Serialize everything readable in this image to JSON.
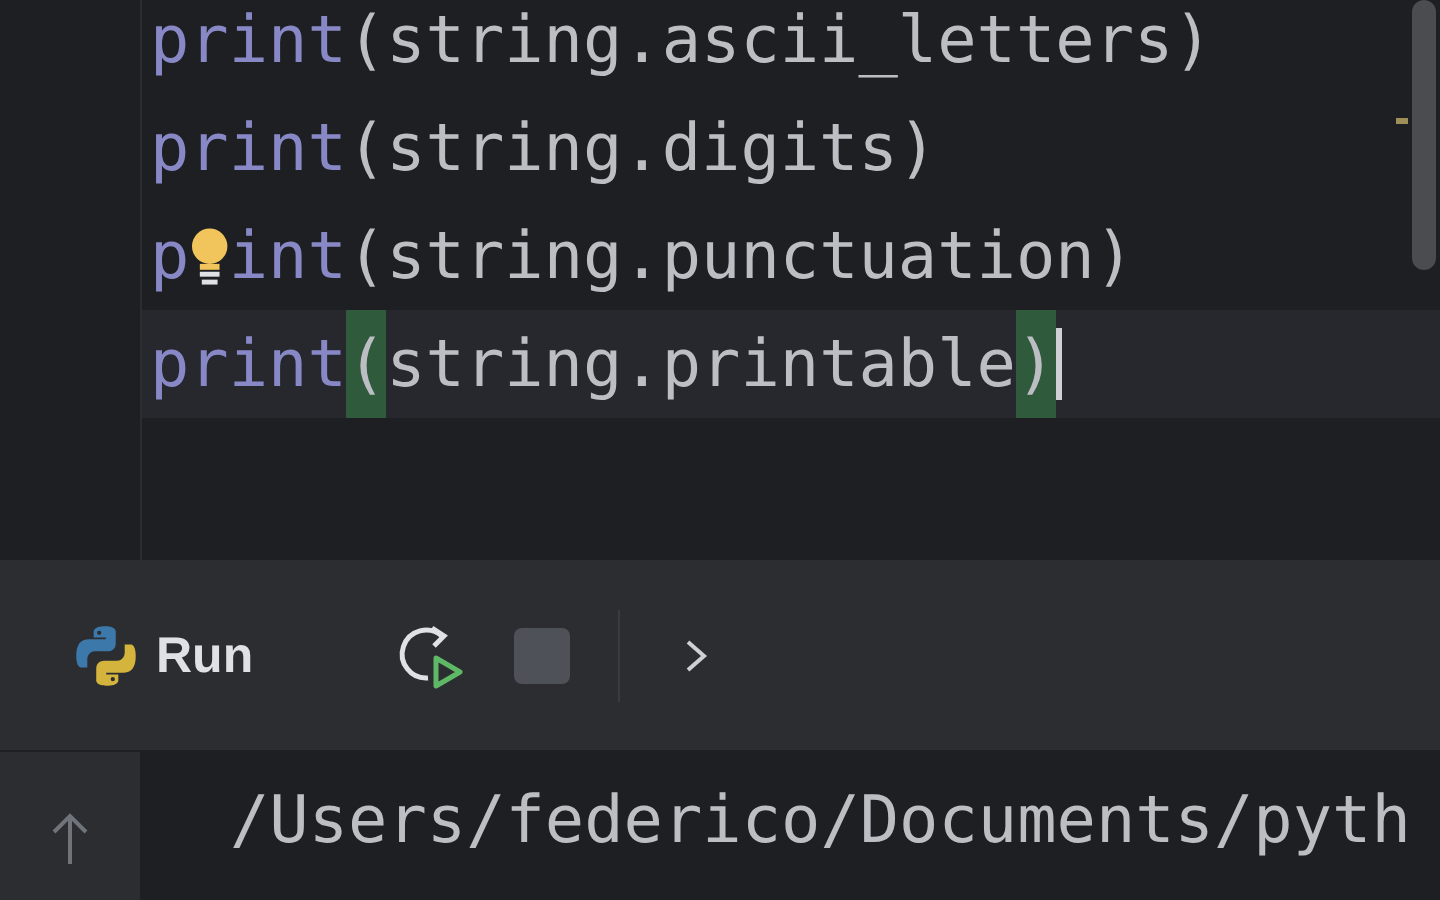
{
  "editor": {
    "lines": [
      {
        "current": false,
        "segments": [
          {
            "kind": "builtin",
            "text": "print"
          },
          {
            "kind": "plain",
            "text": "(string.ascii_letters)"
          }
        ]
      },
      {
        "current": false,
        "segments": [
          {
            "kind": "builtin",
            "text": "print"
          },
          {
            "kind": "plain",
            "text": "(string.digits)"
          }
        ]
      },
      {
        "current": false,
        "segments": [
          {
            "kind": "builtin",
            "text": "p"
          },
          {
            "kind": "intention"
          },
          {
            "kind": "builtin",
            "text": "int"
          },
          {
            "kind": "plain",
            "text": "(string.punctuation)"
          }
        ]
      },
      {
        "current": true,
        "segments": [
          {
            "kind": "builtin",
            "text": "print"
          },
          {
            "kind": "match",
            "text": "("
          },
          {
            "kind": "plain",
            "text": "string.printable"
          },
          {
            "kind": "match",
            "text": ")"
          }
        ]
      }
    ]
  },
  "run_panel": {
    "title": "Run",
    "output": [
      "/Users/federico/Documents/pyth"
    ]
  }
}
